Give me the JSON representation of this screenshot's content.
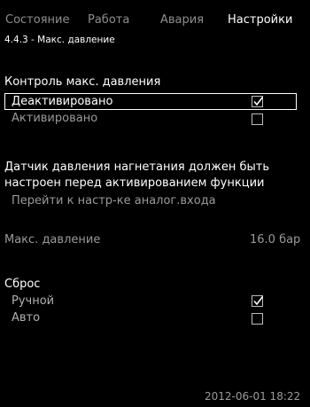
{
  "tabs": [
    {
      "label": "Состояние",
      "active": false
    },
    {
      "label": "Работа",
      "active": false
    },
    {
      "label": "Авария",
      "active": false
    },
    {
      "label": "Настройки",
      "active": true
    }
  ],
  "breadcrumb": "4.4.3 - Макс. давление",
  "max_pressure_control": {
    "title": "Контроль макс. давления",
    "options": [
      {
        "label": "Деактивировано",
        "checked": true,
        "selected": true
      },
      {
        "label": "Активировано",
        "checked": false,
        "selected": false
      }
    ]
  },
  "note": {
    "line1": "Датчик давления нагнетания должен быть",
    "line2": "настроен перед активированием функции"
  },
  "analog_input_link": "Перейти к настр-ке аналог.входа",
  "max_pressure": {
    "label": "Макс. давление",
    "value": "16.0 бар"
  },
  "reset": {
    "title": "Сброс",
    "options": [
      {
        "label": "Ручной",
        "checked": true
      },
      {
        "label": "Авто",
        "checked": false
      }
    ]
  },
  "status_bar": {
    "datetime": "2012-06-01 18:22"
  }
}
